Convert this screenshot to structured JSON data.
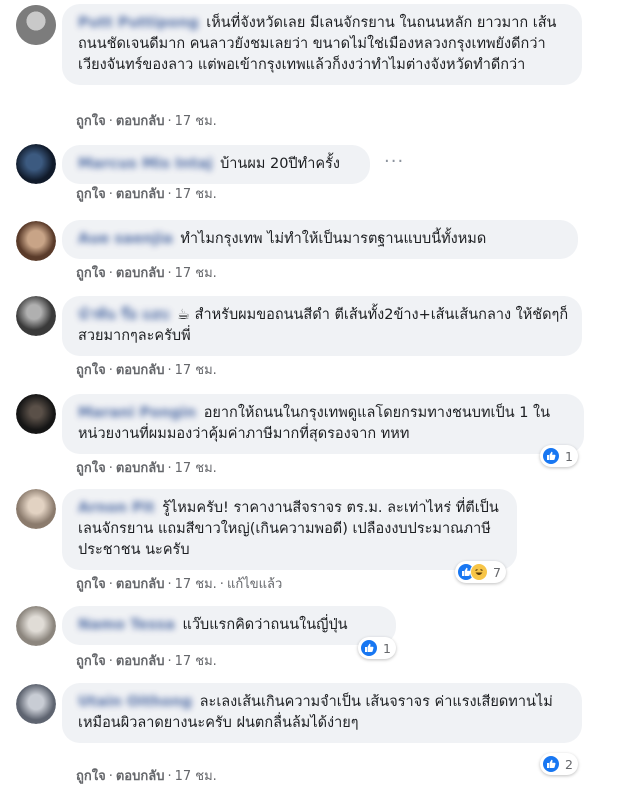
{
  "comments": [
    {
      "author": "Putt Puttipong",
      "text": "เห็นที่จังหวัดเลย มีเลนจักรยาน ในถนนหลัก ยาวมาก เส้นถนนชัดเจนดีมาก คนลาวยังชมเลยว่า ขนาดไม่ใช่เมืองหลวงกรุงเทพยังดีกว่าเวียงจันทร์ของลาว แต่พอเข้ากรุงเทพแล้วก็งงว่าทำไมต่างจังหวัดทำดีกว่า",
      "like": "ถูกใจ",
      "reply": "ตอบกลับ",
      "time": "17 ชม.",
      "edited": "",
      "reactions": "",
      "avatar_color": "#8c8c8c"
    },
    {
      "author": "Marcus Mis Intaj",
      "text": "บ้านผม 20ปีทำครั้ง",
      "like": "ถูกใจ",
      "reply": "ตอบกลับ",
      "time": "17 ชม.",
      "edited": "",
      "reactions": "",
      "avatar_color": "#1f3552"
    },
    {
      "author": "Aue saenjia",
      "text": "ทำไมกรุงเทพ ไม่ทำให้เป็นมารตฐานแบบนี้ทั้งหมด",
      "like": "ถูกใจ",
      "reply": "ตอบกลับ",
      "time": "17 ชม.",
      "edited": "",
      "reactions": "",
      "avatar_color": "#7a5a44"
    },
    {
      "author": "นำพัน ร๊อ แอบ",
      "text": "☕ สำหรับผมขอถนนสีดำ ตีเส้นทั้ง2ข้าง+เส้นเส้นกลาง ให้ชัดๆก็สวยมากๆละครับพี่",
      "like": "ถูกใจ",
      "reply": "ตอบกลับ",
      "time": "17 ชม.",
      "edited": "",
      "reactions": "",
      "avatar_color": "#3d3d3d"
    },
    {
      "author": "Marani Pongin",
      "text": "อยากให้ถนนในกรุงเทพดูแลโดยกรมทางชนบทเป็น 1 ในหน่วยงานที่ผมมองว่าคุ้มค่าภาษีมากที่สุดรองจาก ทหท",
      "like": "ถูกใจ",
      "reply": "ตอบกลับ",
      "time": "17 ชม.",
      "edited": "",
      "reactions": "1",
      "avatar_color": "#2b2b2b"
    },
    {
      "author": "Arnon Pit",
      "text": "รู้ไหมครับ! ราคางานสีจราจร ตร.ม. ละเท่าไหร่ ที่ตีเป็นเลนจักรยาน แถมสีขาวใหญ่(เกินความพอดี) เปลืองงบประมาณภาษีประชาชน นะครับ",
      "like": "ถูกใจ",
      "reply": "ตอบกลับ",
      "time": "17 ชม.",
      "edited": "แก้ไขแล้ว",
      "reactions": "7",
      "avatar_color": "#9a8a7c"
    },
    {
      "author": "Namo Tessa",
      "text": "แว๊บแรกคิดว่าถนนในญี่ปุ่น",
      "like": "ถูกใจ",
      "reply": "ตอบกลับ",
      "time": "17 ชม.",
      "edited": "",
      "reactions": "1",
      "avatar_color": "#b0aaa2"
    },
    {
      "author": "Utain Oithong",
      "text": "ละเลงเส้นเกินความจำเป็น เส้นจราจร ค่าแรงเสียดทานไม่เหมือนผิวลาดยางนะครับ ฝนตกลื่นล้มได้ง่ายๆ",
      "like": "ถูกใจ",
      "reply": "ตอบกลับ",
      "time": "17 ชม.",
      "edited": "",
      "reactions": "2",
      "avatar_color": "#8a8f99"
    }
  ],
  "more_icon": "ellipsis-icon"
}
